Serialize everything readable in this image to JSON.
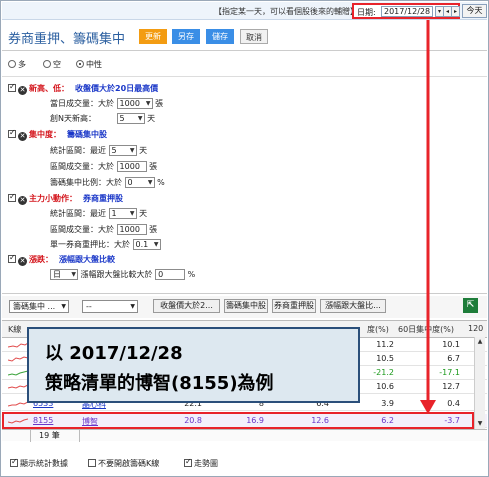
{
  "banner": {
    "hint": "【指定某一天，可以看個股後來的輔贈】",
    "date_label": "日期:",
    "date_value": "2017/12/28",
    "today_label": "今天"
  },
  "header": {
    "title": "券商重押、籌碼集中",
    "buttons": {
      "update": "更新",
      "saveas": "另存",
      "save": "儲存",
      "cancel": "取消"
    }
  },
  "modes": [
    {
      "label": "多",
      "selected": false
    },
    {
      "label": "空",
      "selected": false
    },
    {
      "label": "中性",
      "selected": true
    }
  ],
  "strategies": {
    "s1": {
      "name": "新高、低：",
      "desc": "收盤價大於20日最高價",
      "p1_label": "當日成交量：大於",
      "p1_value": "1000",
      "p1_unit": "張",
      "p2_label": "創N天新高：",
      "p2_value": "5",
      "p2_unit": "天"
    },
    "s2": {
      "name": "集中度：",
      "desc": "籌碼集中股",
      "p1_label": "統計區間：最近",
      "p1_value": "5",
      "p1_unit": "天",
      "p2_label": "區間成交量：大於",
      "p2_value": "1000",
      "p2_unit": "張",
      "p3_label": "籌碼集中比例：大於",
      "p3_value": "0",
      "p3_unit": "%"
    },
    "s3": {
      "name": "主力小動作：",
      "desc": "券商重押股",
      "p1_label": "統計區間：最近",
      "p1_value": "1",
      "p1_unit": "天",
      "p2_label": "區間成交量：大於",
      "p2_value": "1000",
      "p2_unit": "張",
      "p3_label": "單一券商重押比：大於",
      "p3_value": "0.1"
    },
    "s4": {
      "name": "漲跌：",
      "desc": "漲幅跟大盤比較",
      "p1_value": "日",
      "p1_label": "漲幅跟大盤比較大於",
      "p1_input": "0",
      "p1_unit": "%"
    }
  },
  "toolbar": {
    "combo1": "籌碼集中 ...",
    "combo2": "--",
    "btn1": "收盤價大於2...",
    "btn2": "籌碼集中股",
    "btn3": "券商重押股",
    "btn4": "漲幅跟大盤比..."
  },
  "table": {
    "headers": {
      "kline": "K線",
      "col3": "度(%)",
      "col4": "60日集中度(%)",
      "col5": "120"
    },
    "rows": [
      {
        "c3": "11.2",
        "c4": "10.1"
      },
      {
        "c3": "10.5",
        "c4": "6.7"
      },
      {
        "c3": "-21.2",
        "c4": "-17.1"
      },
      {
        "c3": "10.6",
        "c4": "12.7"
      },
      {
        "code": "6533",
        "name": "晶心科",
        "v1": "22.1",
        "v2": "8",
        "v3": "6.4",
        "c3": "3.9",
        "c4": "0.4"
      },
      {
        "code": "8155",
        "name": "博智",
        "v1": "20.8",
        "v2": "16.9",
        "v3": "12.6",
        "c3": "6.2",
        "c4": "-3.7"
      }
    ],
    "count": "19 筆"
  },
  "footer": {
    "opt1": "顯示統計數據",
    "opt2": "不要開啟籌碼K線",
    "opt3": "走勢圖"
  },
  "callout": {
    "line1": "以 2017/12/28",
    "line2": "策略清單的博智(8155)為例"
  },
  "colors": {
    "highlight_red": "#e8232a",
    "accent_blue": "#3a8ee6",
    "accent_orange": "#f39c12",
    "row_purple": "#6a36c9"
  }
}
